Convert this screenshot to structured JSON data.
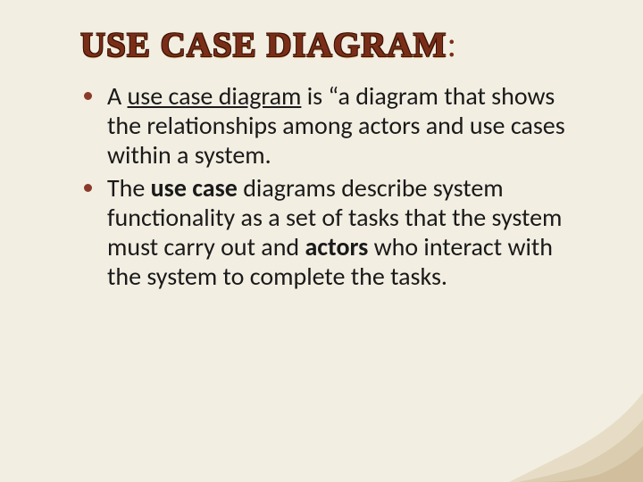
{
  "title_main": "use case diagram",
  "title_colon": ":",
  "bullets": [
    {
      "pre": "A ",
      "underlined": "use case diagram",
      "post": "  is “a diagram that shows the relationships among actors and use cases within a system."
    },
    {
      "t0": "The ",
      "b1": "use case",
      "t1": " diagrams describe system functionality as a set of tasks that the system must carry out and ",
      "b2": "actors",
      "t2": " who interact with the system to complete the tasks."
    }
  ]
}
